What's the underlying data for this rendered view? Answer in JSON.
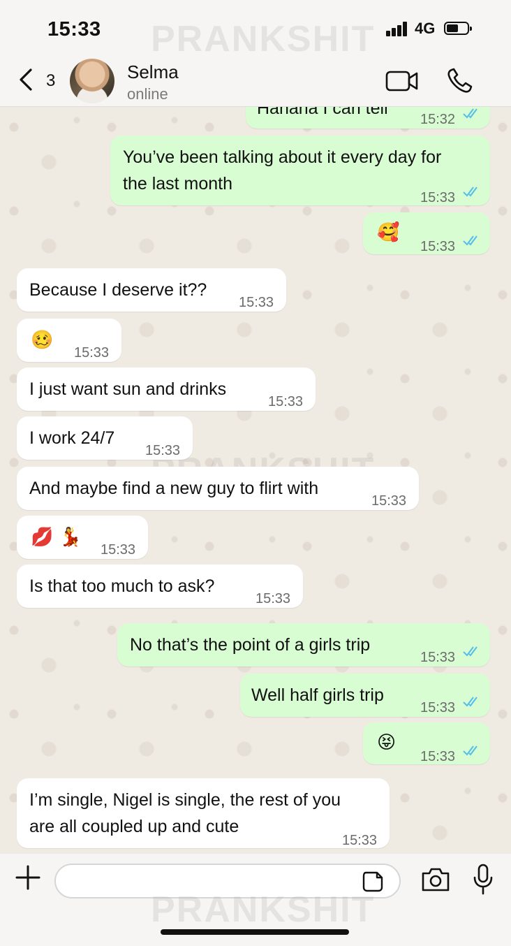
{
  "status": {
    "time": "15:33",
    "network": "4G"
  },
  "watermark": "PRANKSHIT",
  "header": {
    "back_count": "3",
    "name": "Selma",
    "presence": "online"
  },
  "messages": [
    {
      "dir": "out",
      "text": "Hahaha I can tell",
      "time": "15:32",
      "read": true
    },
    {
      "dir": "out",
      "text_lines": [
        "You’ve been talking about it every day for",
        "the last month"
      ],
      "time": "15:33",
      "read": true
    },
    {
      "dir": "out",
      "emoji": "🥰",
      "time": "15:33",
      "read": true
    },
    {
      "dir": "in",
      "text": "Because I deserve it??",
      "time": "15:33"
    },
    {
      "dir": "in",
      "emoji": "🥴",
      "time": "15:33"
    },
    {
      "dir": "in",
      "text": "I just want sun and drinks",
      "time": "15:33"
    },
    {
      "dir": "in",
      "text": "I work 24/7",
      "time": "15:33"
    },
    {
      "dir": "in",
      "text": "And maybe find a new guy to flirt with",
      "time": "15:33"
    },
    {
      "dir": "in",
      "emoji": "💋 💃",
      "time": "15:33"
    },
    {
      "dir": "in",
      "text": "Is that too much to ask?",
      "time": "15:33"
    },
    {
      "dir": "out",
      "text": "No that’s the point of a girls trip",
      "time": "15:33",
      "read": true
    },
    {
      "dir": "out",
      "text": "Well half girls trip",
      "time": "15:33",
      "read": true
    },
    {
      "dir": "out",
      "emoji": "😝",
      "time": "15:33",
      "read": true
    },
    {
      "dir": "in",
      "text_lines": [
        "I’m single, Nigel is single, the rest of you",
        "are all coupled up and cute"
      ],
      "time": "15:33"
    }
  ],
  "composer": {
    "value": "",
    "placeholder": ""
  },
  "colors": {
    "outgoing": "#d9fdd3",
    "incoming": "#ffffff",
    "read_ticks": "#53bdeb",
    "background": "#efeae2"
  }
}
